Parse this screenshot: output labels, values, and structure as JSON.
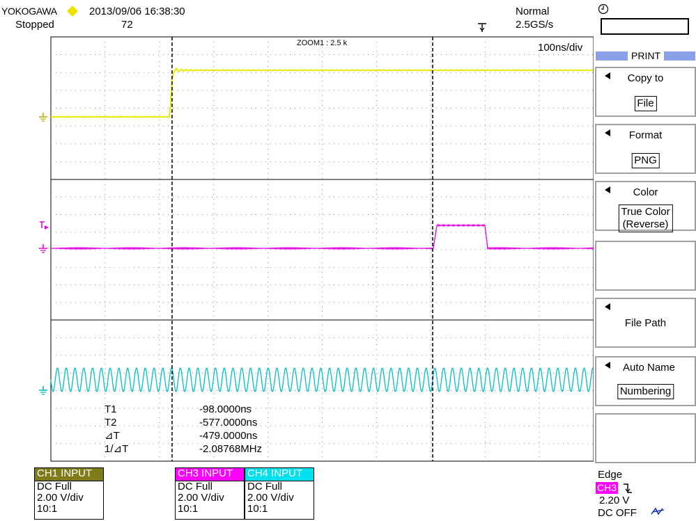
{
  "header": {
    "brand": "YOKOGAWA",
    "datetime": "2013/09/06 16:38:30",
    "status": "Stopped",
    "record_count": "72",
    "acq_mode": "Normal",
    "sample_rate": "2.5GS/s",
    "zoom_label": "ZOOM1 : 2.5 k",
    "time_div": "100ns/div"
  },
  "menu": {
    "title": "PRINT",
    "buttons": [
      {
        "label": "Copy to",
        "value": "File"
      },
      {
        "label": "Format",
        "value": "PNG"
      },
      {
        "label": "Color",
        "value": "True Color\n(Reverse)"
      },
      {
        "label": "",
        "value": ""
      },
      {
        "label": "File Path",
        "value": ""
      },
      {
        "label": "Auto Name",
        "value": "Numbering"
      },
      {
        "label": "",
        "value": ""
      }
    ]
  },
  "cursor_readout": {
    "rows": [
      {
        "label": "T1",
        "value": "-98.0000ns"
      },
      {
        "label": "T2",
        "value": "-577.0000ns"
      },
      {
        "label": "⊿T",
        "value": "-479.0000ns"
      },
      {
        "label": "1/⊿T",
        "value": "-2.08768MHz"
      }
    ]
  },
  "channels": [
    {
      "header": "CH1 INPUT",
      "coupling": "DC Full",
      "scale": "2.00 V/div",
      "probe": "10:1",
      "color": "#7f7a1a"
    },
    {
      "header": "CH3 INPUT",
      "coupling": "DC Full",
      "scale": "2.00 V/div",
      "probe": "10:1",
      "color": "#ff00ff"
    },
    {
      "header": "CH4 INPUT",
      "coupling": "DC Full",
      "scale": "2.00 V/div",
      "probe": "10:1",
      "color": "#00e0ee"
    }
  ],
  "trigger": {
    "mode": "Edge",
    "source": "CH3",
    "level": "2.20 V",
    "hf_reject": "DC OFF"
  },
  "colors": {
    "ch1_trace": "#e8e800",
    "ch3_trace": "#e000e0",
    "ch4_trace": "#00c0c8",
    "menu_bar": "#8aa0e8",
    "brand_diamond": "#f0e000"
  }
}
